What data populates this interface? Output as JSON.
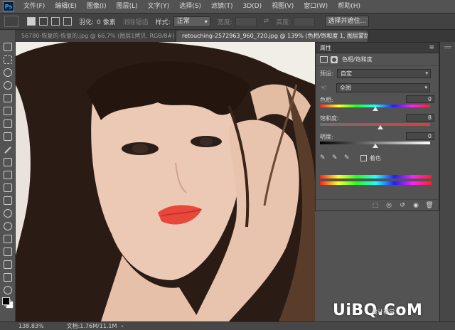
{
  "app": {
    "logo": "Ps"
  },
  "menu": [
    "文件(F)",
    "编辑(E)",
    "图像(I)",
    "图层(L)",
    "文字(Y)",
    "选择(S)",
    "滤镜(T)",
    "3D(D)",
    "视图(V)",
    "窗口(W)",
    "帮助(H)"
  ],
  "options": {
    "feather_label": "羽化:",
    "feather_value": "0 像素",
    "antialias_label": "消除锯齿",
    "style_label": "样式:",
    "style_value": "正常",
    "width_label": "宽度:",
    "height_label": "高度:",
    "select_mask_button": "选择并遮住..."
  },
  "tabs": [
    {
      "label": "56780-恢复的-恢复的.jpg @ 66.7% (图层1拷贝, RGB/8#) *",
      "close": "×"
    },
    {
      "label": "retouching-2572963_960_720.jpg @ 139% (色相/饱和度 1, 图层蒙版/8) *",
      "close": "×"
    }
  ],
  "properties": {
    "title": "属性",
    "menu_icon": "≡",
    "adjustment_label": "色相/饱和度",
    "preset_label": "预设:",
    "preset_value": "自定",
    "channel_value": "全图",
    "hue_label": "色相:",
    "hue_value": "0",
    "saturation_label": "饱和度:",
    "saturation_value": "8",
    "lightness_label": "明度:",
    "lightness_value": "0",
    "colorize_label": "着色"
  },
  "status": {
    "zoom": "138.83%",
    "doc": "文档:1.76M/11.1M",
    "arrow": "›"
  },
  "watermark": {
    "main": "UiBQ.CoM",
    "sub": "设计视觉"
  },
  "colors": {
    "ui_background": "#535353",
    "panel_header": "#3b3b3b",
    "accent": "#31a8ff",
    "lips": "#e8473a"
  }
}
